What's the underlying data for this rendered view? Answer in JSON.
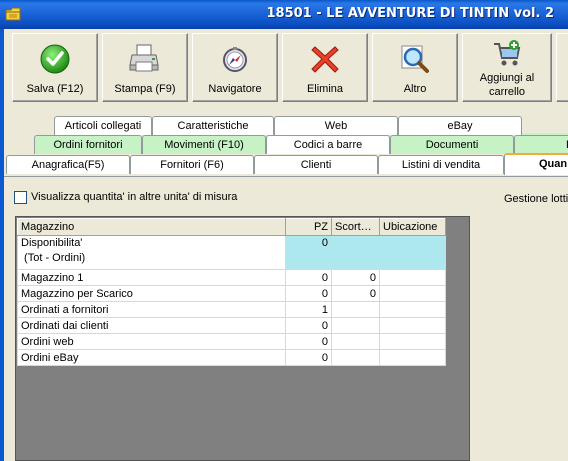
{
  "window": {
    "title": "18501 - LE AVVENTURE DI TINTIN vol. 2",
    "icon": "folder-app-icon"
  },
  "toolbar": {
    "buttons": [
      {
        "label": "Salva (F12)",
        "icon": "check-circle-icon"
      },
      {
        "label": "Stampa (F9)",
        "icon": "printer-icon"
      },
      {
        "label": "Navigatore",
        "icon": "compass-icon"
      },
      {
        "label": "Elimina",
        "icon": "delete-x-icon"
      },
      {
        "label": "Altro",
        "icon": "magnifier-icon"
      },
      {
        "label1": "Aggiungi al",
        "label2": "carrello",
        "icon": "cart-icon"
      }
    ]
  },
  "tabs": {
    "row1": [
      "Articoli collegati",
      "Caratteristiche",
      "Web",
      "eBay"
    ],
    "row2": [
      "Ordini fornitori",
      "Movimenti (F10)",
      "Codici a barre",
      "Documenti",
      "F"
    ],
    "row3": [
      "Anagrafica(F5)",
      "Fornitori (F6)",
      "Clienti",
      "Listini di vendita",
      "Quan"
    ]
  },
  "panel": {
    "checkbox_label": "Visualizza quantita' in altre unita' di misura",
    "gestione_label": "Gestione lotti"
  },
  "grid": {
    "headers": [
      "Magazzino",
      "PZ",
      "Scort…",
      "Ubicazione"
    ],
    "rows": [
      {
        "label1": "Disponibilita'",
        "label2": " (Tot - Ordini)",
        "pz": "0",
        "scort": "",
        "ubic": ""
      },
      {
        "label": "Magazzino 1",
        "pz": "0",
        "scort": "0",
        "ubic": ""
      },
      {
        "label": "Magazzino per Scarico",
        "pz": "0",
        "scort": "0",
        "ubic": ""
      },
      {
        "label": "Ordinati a fornitori",
        "pz": "1",
        "scort": "",
        "ubic": ""
      },
      {
        "label": "Ordinati dai clienti",
        "pz": "0",
        "scort": "",
        "ubic": ""
      },
      {
        "label": "Ordini web",
        "pz": "0",
        "scort": "",
        "ubic": ""
      },
      {
        "label": "Ordini eBay",
        "pz": "0",
        "scort": "",
        "ubic": ""
      }
    ]
  }
}
